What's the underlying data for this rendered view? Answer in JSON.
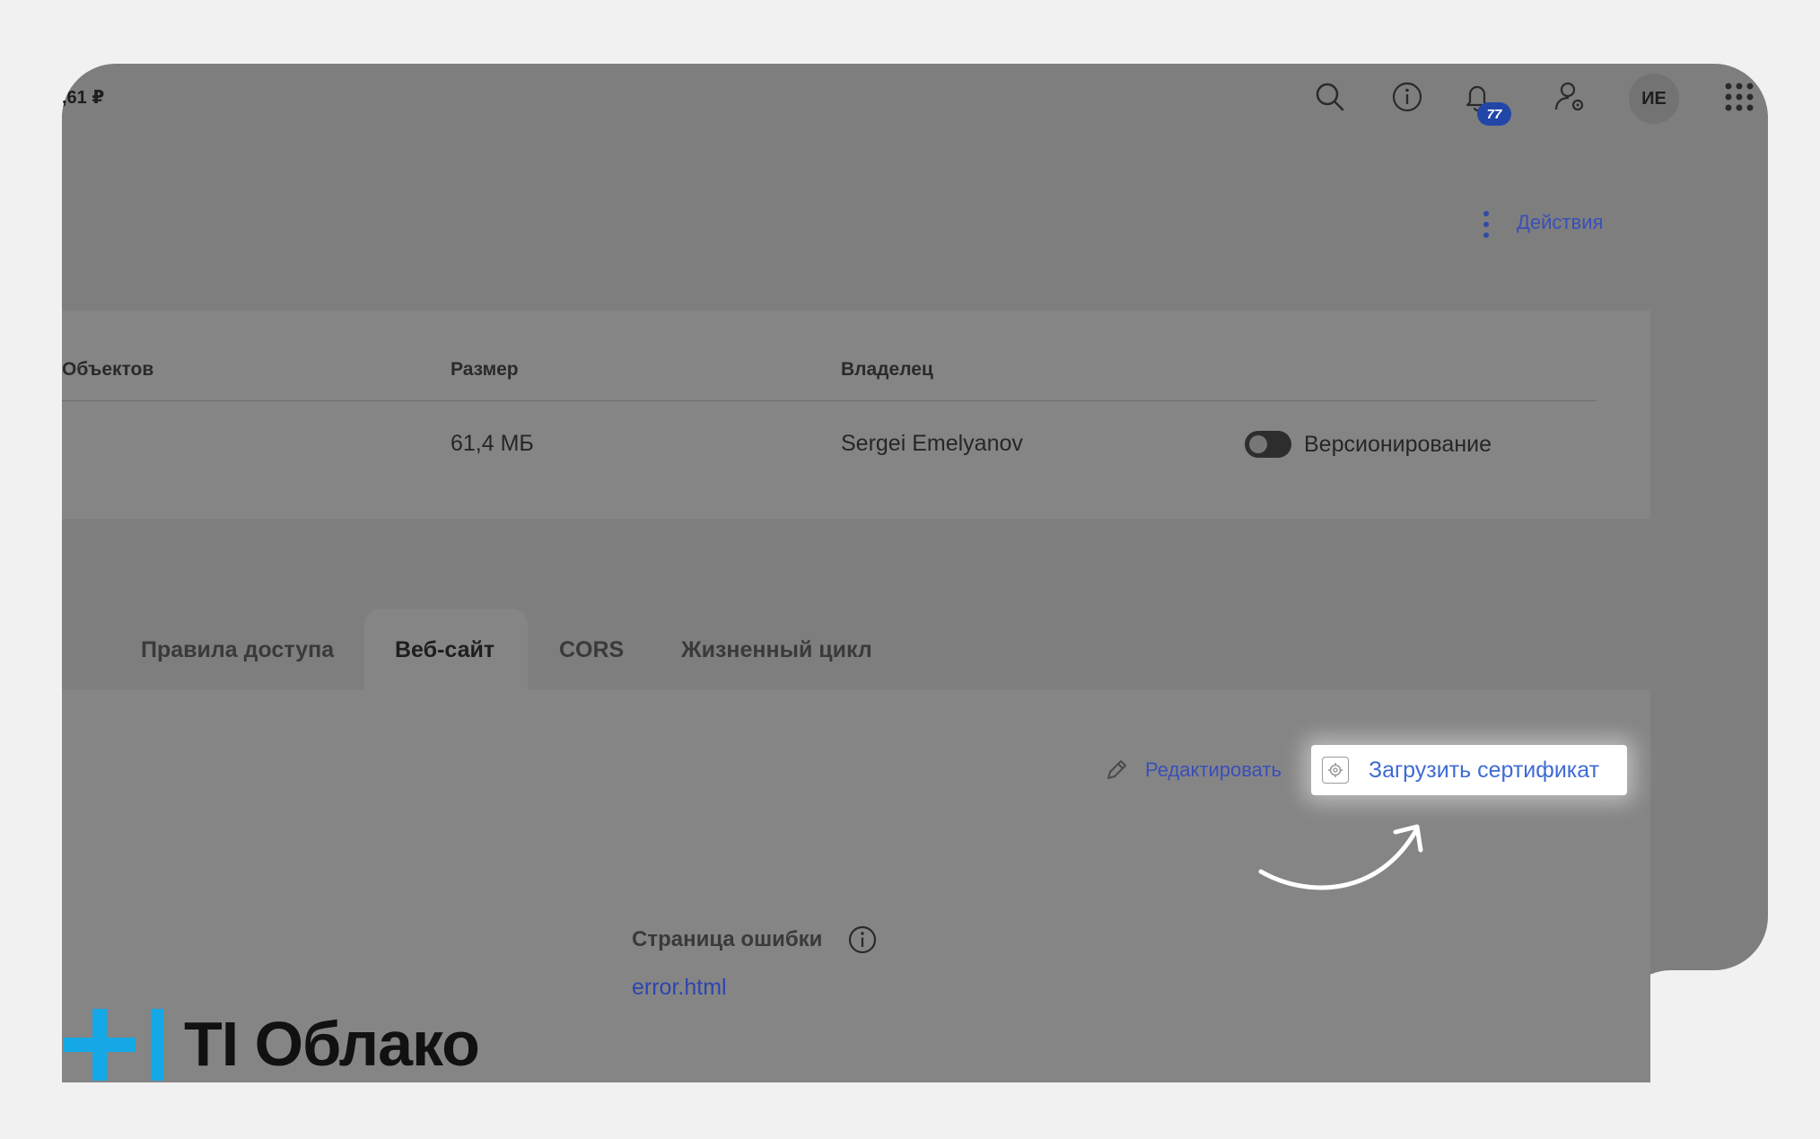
{
  "header": {
    "balance": ",61 ₽",
    "notifications_count": "77",
    "avatar_initials": "ИЕ",
    "icons": [
      "search-icon",
      "info-icon",
      "bell-icon",
      "user-settings-icon",
      "apps-grid-icon"
    ]
  },
  "page": {
    "actions_label": "Действия"
  },
  "bucket_info": {
    "columns": [
      "Объектов",
      "Размер",
      "Владелец"
    ],
    "size": "61,4 МБ",
    "owner": "Sergei Emelyanov",
    "versioning_label": "Версионирование",
    "versioning_enabled": false
  },
  "tabs": [
    {
      "label": "Правила доступа",
      "active": false
    },
    {
      "label": "Веб-сайт",
      "active": true
    },
    {
      "label": "CORS",
      "active": false
    },
    {
      "label": "Жизненный цикл",
      "active": false
    }
  ],
  "website": {
    "edit_label": "Редактировать",
    "upload_cert_label": "Загрузить сертификат",
    "error_page_title": "Страница ошибки",
    "error_page_value": "error.html"
  },
  "logo": {
    "text": "TI Облако",
    "accent_color": "#14a8e6"
  }
}
